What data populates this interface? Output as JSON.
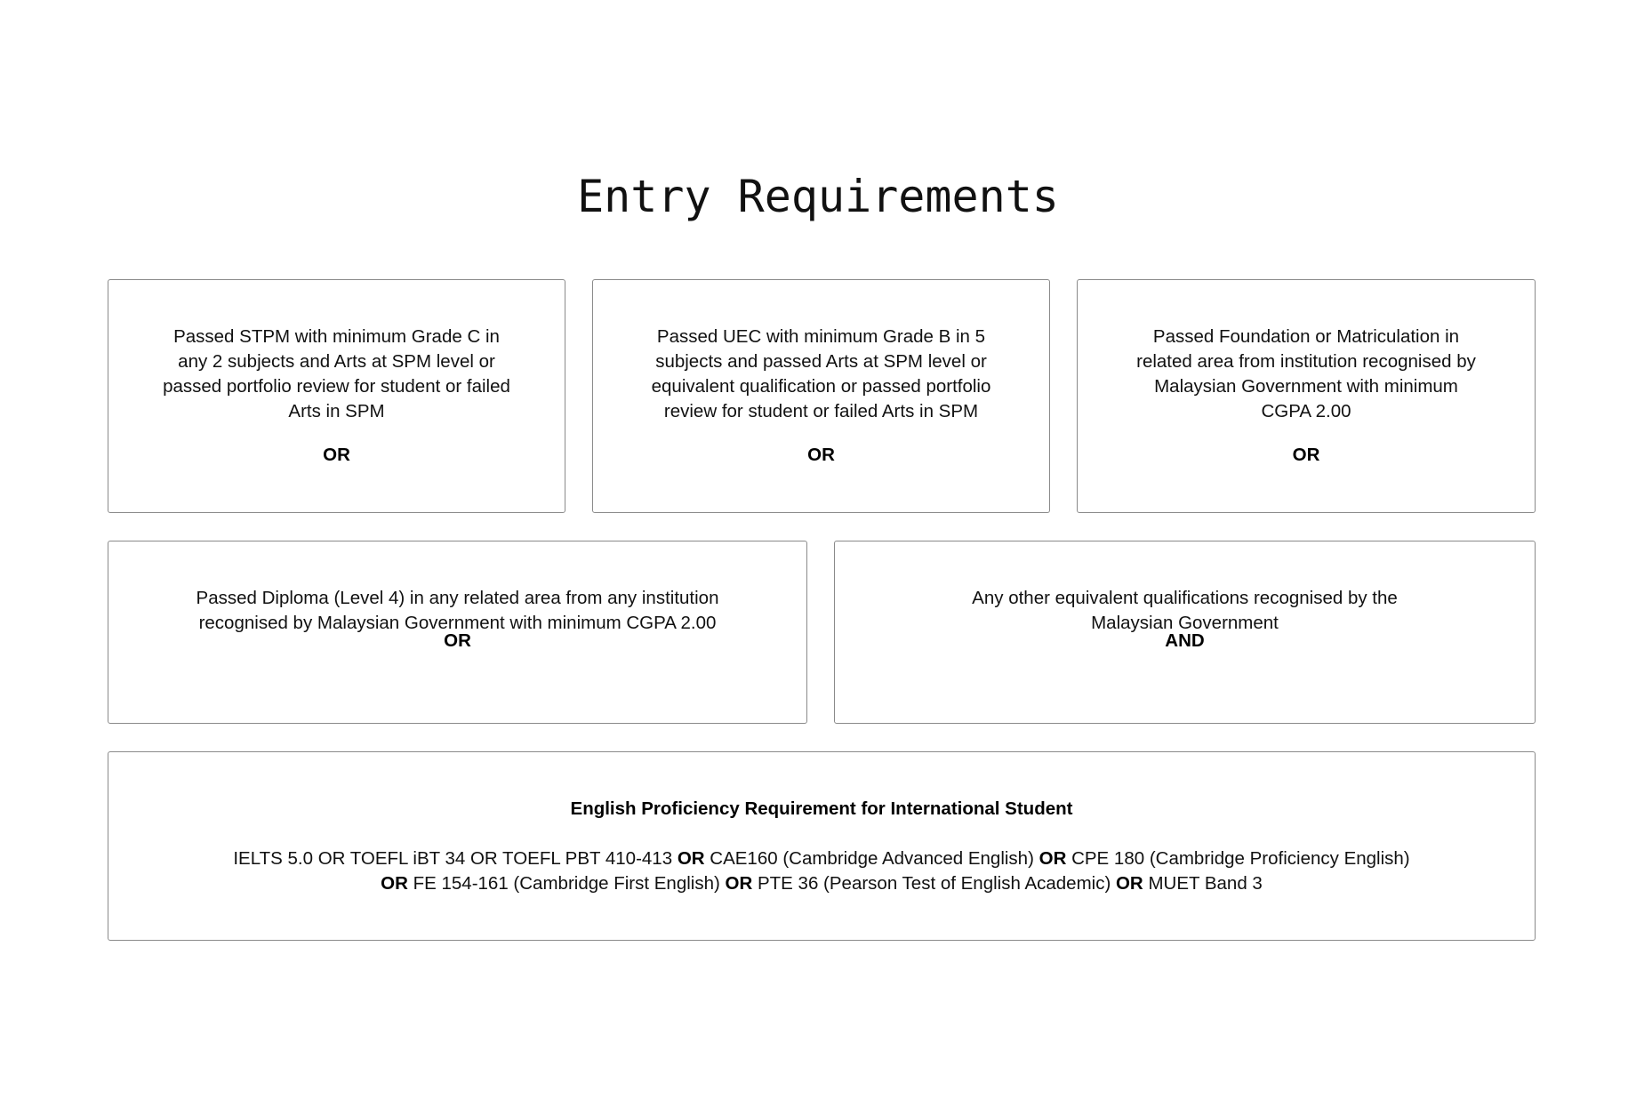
{
  "page": {
    "title": "Entry Requirements"
  },
  "requirements_row1": [
    {
      "text": "Passed STPM with minimum Grade C in any 2 subjects and Arts at SPM level or passed portfolio review for student or failed Arts in SPM",
      "connector": "OR"
    },
    {
      "text": "Passed UEC with minimum Grade B in 5 subjects and passed Arts at SPM level or equivalent qualification or passed portfolio review for student or failed Arts in SPM",
      "connector": "OR"
    },
    {
      "text": "Passed Foundation or Matriculation in related area from institution recognised by Malaysian Government with minimum CGPA 2.00",
      "connector": "OR"
    }
  ],
  "requirements_row2": [
    {
      "text": "Passed Diploma (Level 4) in any related area from any institution recognised by Malaysian Government with minimum CGPA 2.00",
      "connector": "OR"
    },
    {
      "text": "Any other equivalent qualifications recognised by the Malaysian Government",
      "connector": "AND"
    }
  ],
  "english": {
    "title": "English Proficiency Requirement for International Student",
    "options": [
      "IELTS 5.0 OR TOEFL iBT 34 OR TOEFL PBT 410-413",
      "CAE160 (Cambridge Advanced English)",
      "CPE 180 (Cambridge Proficiency English)",
      "FE 154-161 (Cambridge First English)",
      "PTE 36 (Pearson Test of English Academic)",
      "MUET Band 3"
    ],
    "separator": "OR"
  }
}
